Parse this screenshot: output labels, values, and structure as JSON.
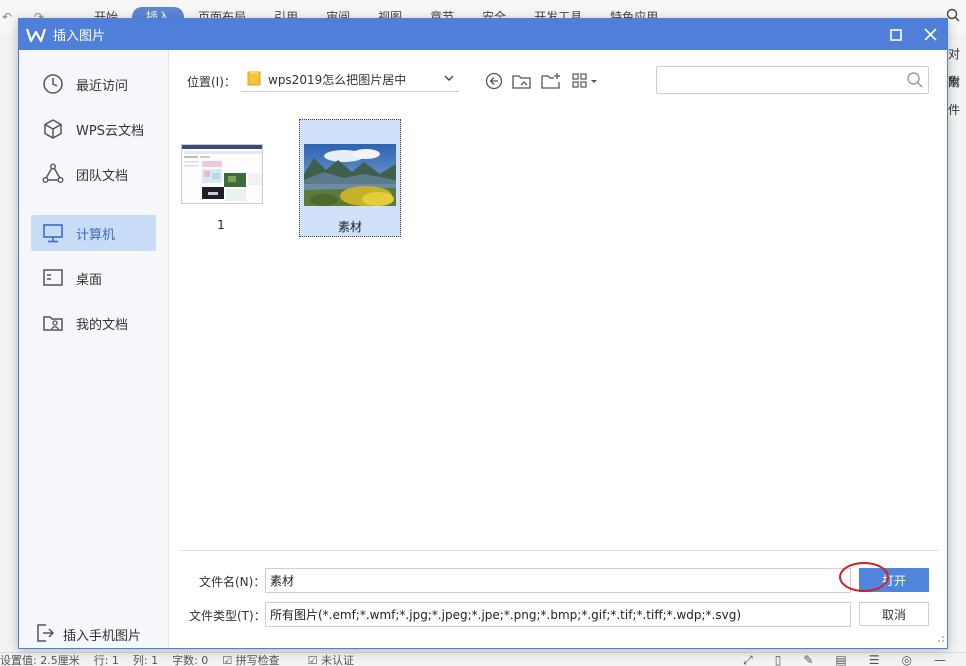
{
  "background": {
    "tabs": [
      "开始",
      "插入",
      "页面布局",
      "引用",
      "审阅",
      "视图",
      "章节",
      "安全",
      "开发工具",
      "特色应用"
    ],
    "active_tab_index": 1,
    "right_col": [
      "对象",
      "附件"
    ],
    "status": {
      "items": [
        "设置值: 2.5厘米",
        "行: 1",
        "列: 1",
        "字数: 0",
        "拼写检查",
        "未认证"
      ]
    }
  },
  "dialog": {
    "title": "插入图片",
    "sidebar": {
      "items": [
        {
          "label": "最近访问",
          "icon": "clock-icon"
        },
        {
          "label": "WPS云文档",
          "icon": "cube-icon"
        },
        {
          "label": "团队文档",
          "icon": "team-icon"
        },
        {
          "label": "计算机",
          "icon": "monitor-icon",
          "active": true
        },
        {
          "label": "桌面",
          "icon": "desktop-icon"
        },
        {
          "label": "我的文档",
          "icon": "user-folder-icon"
        }
      ],
      "bottom_label": "插入手机图片"
    },
    "toolbar": {
      "location_label": "位置(I)：",
      "path": "wps2019怎么把图片居中",
      "search_placeholder": ""
    },
    "files": [
      {
        "label": "1",
        "selected": false
      },
      {
        "label": "素材",
        "selected": true
      }
    ],
    "filename_label": "文件名(N)：",
    "filename_value": "素材",
    "filetype_label": "文件类型(T)：",
    "filetype_value": "所有图片(*.emf;*.wmf;*.jpg;*.jpeg;*.jpe;*.png;*.bmp;*.gif;*.tif;*.tiff;*.wdp;*.svg)",
    "open_label": "打开",
    "cancel_label": "取消"
  },
  "colors": {
    "titlebar": "#4f7fd9",
    "accent": "#4f86db",
    "active_bg": "#c9dcf7",
    "highlight": "#d42020"
  }
}
